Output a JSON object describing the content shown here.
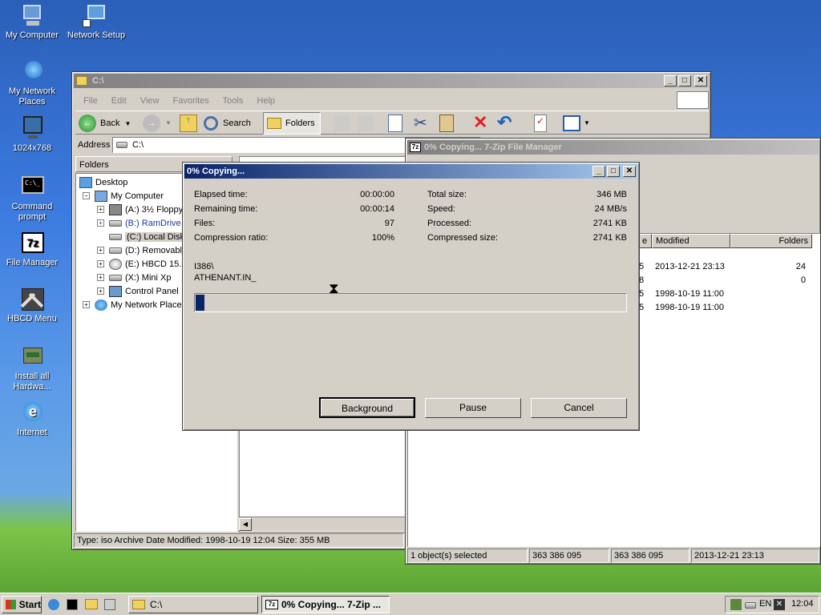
{
  "desktop": {
    "icons": [
      {
        "label": "My Computer"
      },
      {
        "label": "Network Setup"
      },
      {
        "label": "My Network Places"
      },
      {
        "label": "1024x768"
      },
      {
        "label": "Command prompt"
      },
      {
        "label": "File Manager"
      },
      {
        "label": "HBCD Menu"
      },
      {
        "label": "Install all Hardwa..."
      },
      {
        "label": "Internet"
      }
    ]
  },
  "explorer": {
    "title": "C:\\",
    "menu": [
      "File",
      "Edit",
      "View",
      "Favorites",
      "Tools",
      "Help"
    ],
    "toolbar": {
      "back": "Back",
      "search": "Search",
      "folders": "Folders"
    },
    "address_label": "Address",
    "address_value": "C:\\",
    "folders_header": "Folders",
    "tree": [
      {
        "label": "Desktop"
      },
      {
        "label": "My Computer"
      },
      {
        "label": "(A:) 3½ Floppy"
      },
      {
        "label": "(B:) RamDrive"
      },
      {
        "label": "(C:) Local Disk"
      },
      {
        "label": "(D:) Removable"
      },
      {
        "label": "(E:) HBCD 15.2"
      },
      {
        "label": "(X:) Mini Xp"
      },
      {
        "label": "Control Panel"
      },
      {
        "label": "My Network Places"
      }
    ],
    "status": "Type: iso Archive Date Modified: 1998-10-19 12:04 Size: 355 MB"
  },
  "sevenzip": {
    "title": "0% Copying... 7-Zip File Manager",
    "columns": {
      "modified": "Modified",
      "folders": "Folders",
      "col_e": "e"
    },
    "rows": [
      {
        "prefix": "5",
        "modified": "2013-12-21 23:13",
        "folders": "24"
      },
      {
        "prefix": "8",
        "modified": "",
        "folders": "0"
      },
      {
        "prefix": "5",
        "modified": "1998-10-19 11:00",
        "folders": ""
      },
      {
        "prefix": "5",
        "modified": "1998-10-19 11:00",
        "folders": ""
      }
    ],
    "status": [
      "1 object(s) selected",
      "363 386 095",
      "363 386 095",
      "2013-12-21 23:13"
    ]
  },
  "dialog": {
    "title": "0% Copying...",
    "elapsed_label": "Elapsed time:",
    "elapsed_value": "00:00:00",
    "remaining_label": "Remaining time:",
    "remaining_value": "00:00:14",
    "files_label": "Files:",
    "files_value": "97",
    "ratio_label": "Compression ratio:",
    "ratio_value": "100%",
    "total_label": "Total size:",
    "total_value": "346 MB",
    "speed_label": "Speed:",
    "speed_value": "24 MB/s",
    "processed_label": "Processed:",
    "processed_value": "2741 KB",
    "compressed_label": "Compressed size:",
    "compressed_value": "2741 KB",
    "path_line1": "I386\\",
    "path_line2": "ATHENANT.IN_",
    "progress_percent": 2,
    "buttons": {
      "background": "Background",
      "pause": "Pause",
      "cancel": "Cancel"
    }
  },
  "taskbar": {
    "start": "Start",
    "tasks": [
      {
        "label": "C:\\"
      },
      {
        "label": "0% Copying... 7-Zip ..."
      }
    ],
    "lang": "EN",
    "clock": "12:04"
  }
}
